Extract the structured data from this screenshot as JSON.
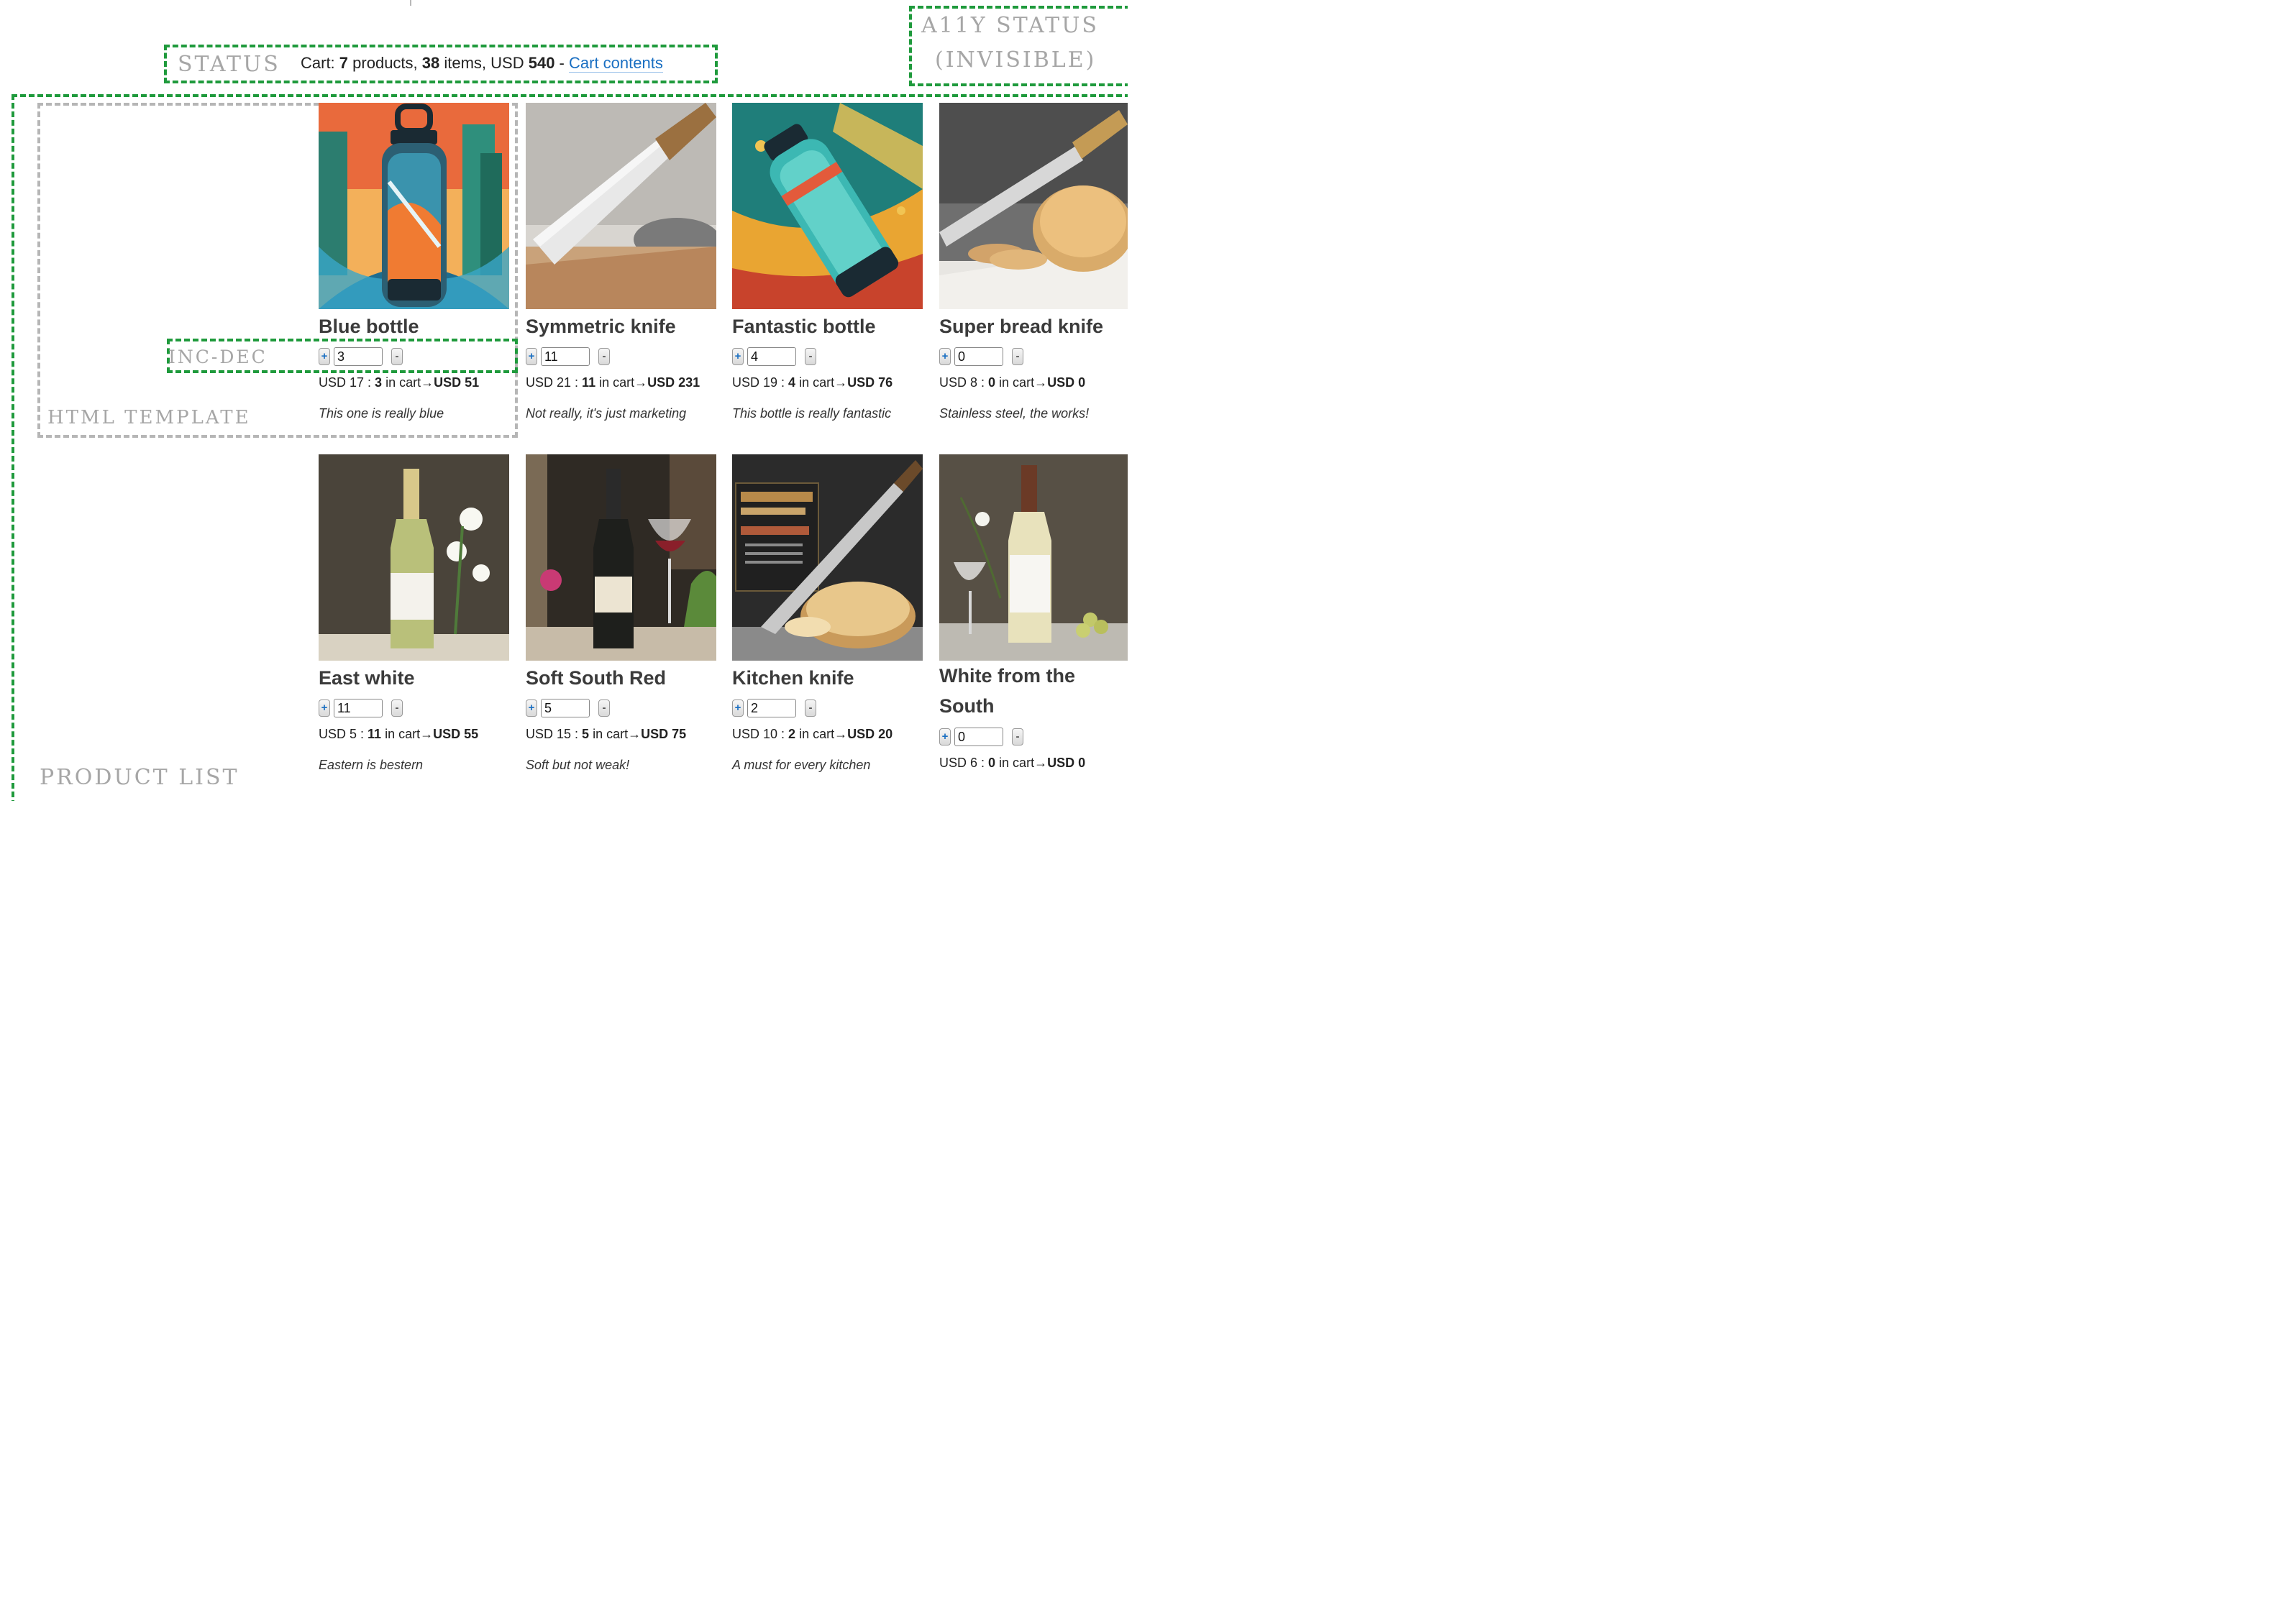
{
  "annotations": {
    "status_label": "STATUS",
    "a11y_label_1": "A11Y STATUS",
    "a11y_label_2": "(INVISIBLE)",
    "inc_dec_label": "INC-DEC",
    "html_template_label": "HTML TEMPLATE",
    "product_list_label": "PRODUCT LIST"
  },
  "status": {
    "prefix": "Cart: ",
    "products_count": "7",
    "products_word": " products, ",
    "items_count": "38",
    "items_word": " items, USD ",
    "total": "540",
    "separator": " - ",
    "link_label": "Cart contents"
  },
  "products": [
    {
      "name": "Blue bottle",
      "qty": "3",
      "price": "USD 17",
      "in_cart": "3",
      "in_cart_word": " in cart",
      "total": "USD 51",
      "desc": "This one is really blue",
      "image": "bottle-illustration"
    },
    {
      "name": "Symmetric knife",
      "qty": "11",
      "price": "USD 21",
      "in_cart": "11",
      "in_cart_word": " in cart",
      "total": "USD 231",
      "desc": "Not really, it's just marketing",
      "image": "knife-photo"
    },
    {
      "name": "Fantastic bottle",
      "qty": "4",
      "price": "USD 19",
      "in_cart": "4",
      "in_cart_word": " in cart",
      "total": "USD 76",
      "desc": "This bottle is really fantastic",
      "image": "bottle-illustration"
    },
    {
      "name": "Super bread knife",
      "qty": "0",
      "price": "USD 8",
      "in_cart": "0",
      "in_cart_word": " in cart",
      "total": "USD 0",
      "desc": "Stainless steel, the works!",
      "image": "bread-knife-photo"
    },
    {
      "name": "East white",
      "qty": "11",
      "price": "USD 5",
      "in_cart": "11",
      "in_cart_word": " in cart",
      "total": "USD 55",
      "desc": "Eastern is bestern",
      "image": "wine-bottle-photo"
    },
    {
      "name": "Soft South Red",
      "qty": "5",
      "price": "USD 15",
      "in_cart": "5",
      "in_cart_word": " in cart",
      "total": "USD 75",
      "desc": "Soft but not weak!",
      "image": "red-wine-photo"
    },
    {
      "name": "Kitchen knife",
      "qty": "2",
      "price": "USD 10",
      "in_cart": "2",
      "in_cart_word": " in cart",
      "total": "USD 20",
      "desc": "A must for every kitchen",
      "image": "knife-bread-photo"
    },
    {
      "name": "White from the South",
      "qty": "0",
      "price": "USD 6",
      "in_cart": "0",
      "in_cart_word": " in cart",
      "total": "USD 0",
      "desc": "",
      "image": "white-wine-photo"
    }
  ],
  "buttons": {
    "inc": "+",
    "dec": "-",
    "arrow": "→",
    "colon": " : "
  },
  "colors": {
    "annotation_green": "#1f9a3c",
    "annotation_grey": "#b6b6b6",
    "link_blue": "#1a6fc2"
  }
}
